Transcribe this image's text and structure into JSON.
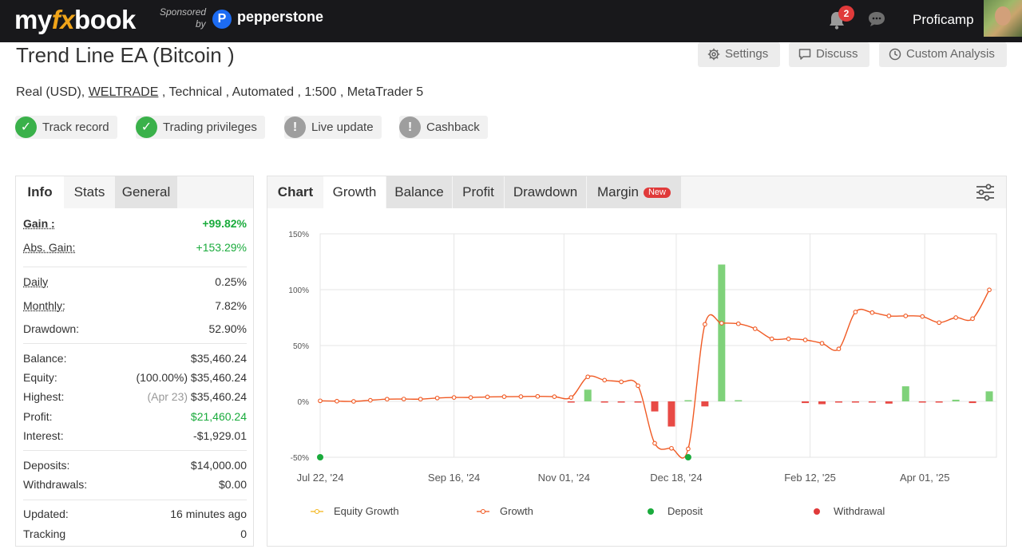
{
  "header": {
    "logo_a": "my",
    "logo_b": "fx",
    "logo_c": "book",
    "sponsored": "Sponsored",
    "by": "by",
    "sponsor_logo_letter": "P",
    "sponsor_name": "pepperstone",
    "notification_count": "2",
    "username": "Proficamp"
  },
  "page": {
    "title": "Trend Line EA (Bitcoin )",
    "buttons": {
      "settings": "Settings",
      "discuss": "Discuss",
      "custom_analysis": "Custom Analysis"
    },
    "subline": {
      "prefix": "Real (USD),",
      "broker": "WELTRADE",
      "suffix": ", Technical , Automated , 1:500 , MetaTrader 5"
    },
    "chips": [
      {
        "label": "Track record",
        "status": "ok"
      },
      {
        "label": "Trading privileges",
        "status": "ok"
      },
      {
        "label": "Live update",
        "status": "warn"
      },
      {
        "label": "Cashback",
        "status": "warn"
      }
    ]
  },
  "stats_panel": {
    "tabs": [
      "Info",
      "Stats",
      "General"
    ],
    "gain": {
      "label": "Gain :",
      "value": "+99.82%"
    },
    "abs_gain": {
      "label": "Abs. Gain:",
      "value": "+153.29%"
    },
    "daily": {
      "label": "Daily",
      "value": "0.25%"
    },
    "monthly": {
      "label": "Monthly:",
      "value": "7.82%"
    },
    "drawdown": {
      "label": "Drawdown:",
      "value": "52.90%"
    },
    "balance": {
      "label": "Balance:",
      "value": "$35,460.24"
    },
    "equity": {
      "label": "Equity:",
      "note": "(100.00%)",
      "value": "$35,460.24"
    },
    "highest": {
      "label": "Highest:",
      "note": "(Apr 23)",
      "value": "$35,460.24"
    },
    "profit": {
      "label": "Profit:",
      "value": "$21,460.24"
    },
    "interest": {
      "label": "Interest:",
      "value": "-$1,929.01"
    },
    "deposits": {
      "label": "Deposits:",
      "value": "$14,000.00"
    },
    "withdrawals": {
      "label": "Withdrawals:",
      "value": "$0.00"
    },
    "updated": {
      "label": "Updated:",
      "value": "16 minutes ago"
    },
    "tracking": {
      "label": "Tracking",
      "value": "0"
    }
  },
  "chart_panel": {
    "tabs": [
      "Chart",
      "Growth",
      "Balance",
      "Profit",
      "Drawdown",
      "Margin"
    ],
    "new_badge": "New"
  },
  "chart_data": {
    "type": "line",
    "y_tick_labels": [
      "150%",
      "100%",
      "50%",
      "0%",
      "-50%"
    ],
    "ylim": [
      -50,
      150
    ],
    "x_tick_labels": [
      "Jul 22, '24",
      "Sep 16, '24",
      "Nov 01, '24",
      "Dec 18, '24",
      "Feb 12, '25",
      "Apr 01, '25"
    ],
    "x_ticks": [
      0,
      56,
      102,
      149,
      205,
      253
    ],
    "x_range": [
      0,
      283
    ],
    "grid": true,
    "legend_position": "bottom",
    "series": [
      {
        "name": "Growth",
        "kind": "line",
        "color": "#f05a24",
        "x": [
          0,
          7,
          14,
          21,
          28,
          35,
          42,
          49,
          56,
          63,
          70,
          77,
          84,
          91,
          98,
          105,
          112,
          119,
          126,
          133,
          140,
          147,
          154,
          161,
          168,
          175,
          182,
          189,
          196,
          203,
          210,
          217,
          224,
          231,
          238,
          245,
          252,
          259,
          266,
          273,
          280
        ],
        "y": [
          0.5,
          0.2,
          0,
          1,
          2,
          2.1,
          2,
          3,
          3.5,
          3.5,
          4,
          4.2,
          4.3,
          4.5,
          4.2,
          3.5,
          22,
          19,
          17.5,
          14,
          -37.5,
          -42,
          -42.5,
          69,
          70,
          69.5,
          65,
          56,
          56,
          55,
          52,
          47,
          80,
          79.5,
          76.5,
          76.5,
          76,
          70.5,
          75,
          74,
          99.82
        ]
      },
      {
        "name": "Equity Growth",
        "kind": "line",
        "color": "#f3b61f",
        "x": [],
        "y": []
      },
      {
        "name": "Bars",
        "kind": "bar",
        "x": [
          105,
          112,
          119,
          126,
          133,
          140,
          147,
          154,
          161,
          168,
          175,
          203,
          210,
          217,
          224,
          231,
          238,
          245,
          252,
          259,
          266,
          273,
          280
        ],
        "y": [
          -0.5,
          10.5,
          -1,
          -0.5,
          -1,
          -9,
          -22.5,
          0,
          -4.5,
          122.5,
          0,
          -1.5,
          -2.5,
          -0.5,
          -0.5,
          -0.5,
          -2,
          13.5,
          -0.5,
          -0.5,
          1.5,
          -1.5,
          9
        ]
      },
      {
        "name": "Deposit",
        "kind": "marker",
        "color": "#1aab3c",
        "x": [
          0,
          154
        ],
        "y": [
          -50,
          -50
        ]
      },
      {
        "name": "Withdrawal",
        "kind": "marker",
        "color": "#e03a3a",
        "x": [],
        "y": []
      }
    ],
    "legend": [
      "Equity Growth",
      "Growth",
      "Deposit",
      "Withdrawal"
    ],
    "bar_colors": {
      "positive": "#7fd27a",
      "negative": "#e84a45"
    }
  }
}
